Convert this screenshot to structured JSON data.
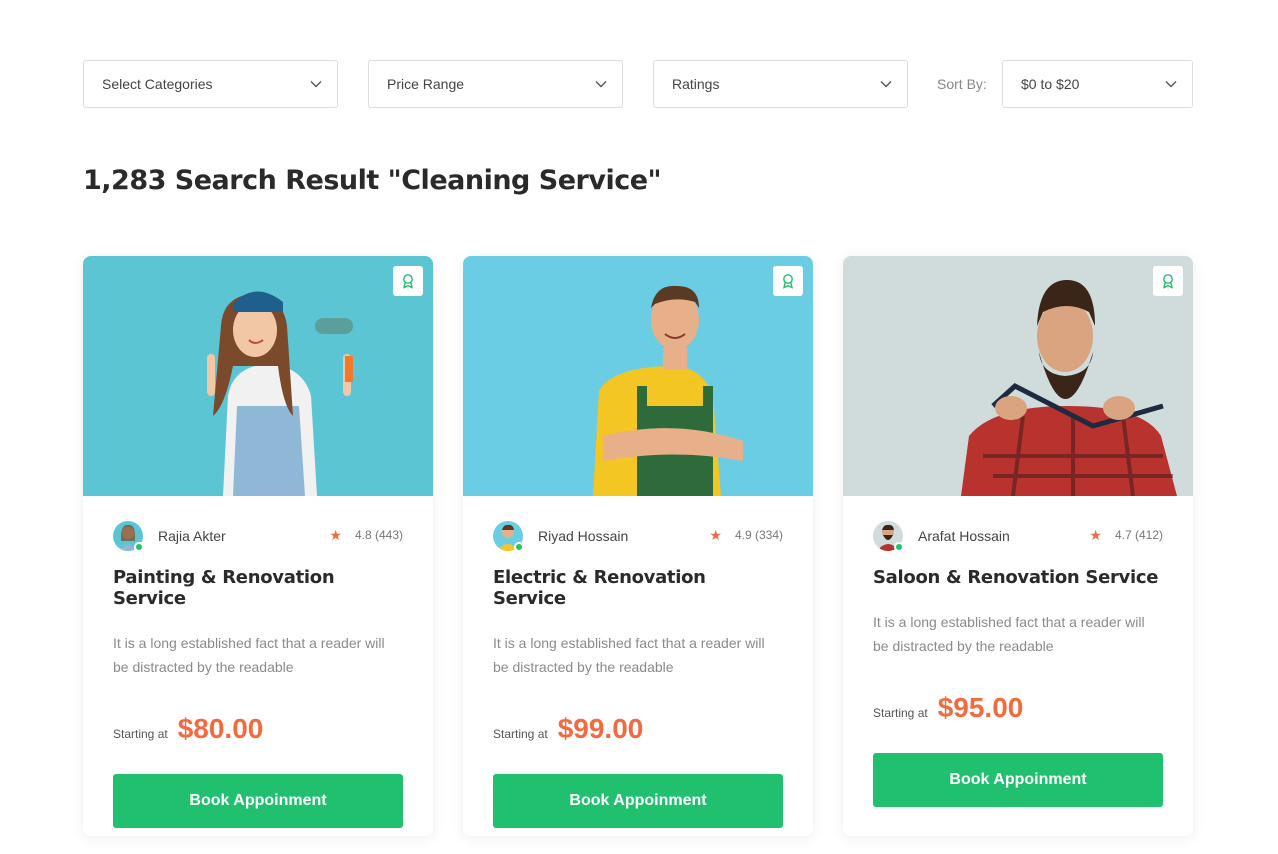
{
  "filters": {
    "categories": "Select Categories",
    "price_range": "Price Range",
    "ratings": "Ratings",
    "sort_label": "Sort By:",
    "sort_value": "$0 to $20"
  },
  "results": {
    "heading": "1,283 Search Result \"Cleaning Service\""
  },
  "cards": [
    {
      "provider": "Rajia Akter",
      "rating": "4.8 (443)",
      "title": "Painting & Renovation Service",
      "description": "It is a long established fact that a reader will be distracted by the readable",
      "starting_label": "Starting at",
      "price": "$80.00",
      "button": "Book Appoinment",
      "photo_bg": "#5cc5d4"
    },
    {
      "provider": "Riyad Hossain",
      "rating": "4.9 (334)",
      "title": "Electric & Renovation Service",
      "description": "It is a long established fact that a reader will be distracted by the readable",
      "starting_label": "Starting at",
      "price": "$99.00",
      "button": "Book Appoinment",
      "photo_bg": "#6bcde4"
    },
    {
      "provider": "Arafat Hossain",
      "rating": "4.7 (412)",
      "title": "Saloon & Renovation Service",
      "description": "It is a long established fact that a reader will be distracted by the readable",
      "starting_label": "Starting at",
      "price": "$95.00",
      "button": "Book Appoinment",
      "photo_bg": "#cfdcdb"
    }
  ],
  "colors": {
    "accent_green": "#21c06f",
    "price_orange": "#f26a3d",
    "online_green": "#22c55e"
  },
  "icons": {
    "dropdown": "chevron-down-icon",
    "badge": "award-icon",
    "rating": "star-icon"
  }
}
